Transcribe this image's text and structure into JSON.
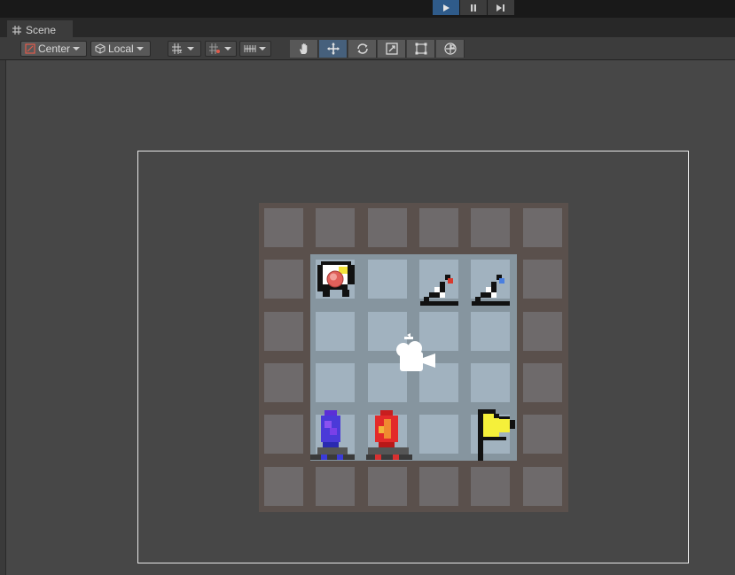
{
  "topbar": {
    "play_controls": [
      {
        "name": "play-button",
        "icon": "play-icon",
        "active": true
      },
      {
        "name": "pause-button",
        "icon": "pause-icon",
        "active": false
      },
      {
        "name": "step-button",
        "icon": "step-icon",
        "active": false
      }
    ]
  },
  "tabs": [
    {
      "label": "Scene",
      "icon": "grid-hash-icon"
    }
  ],
  "toolbar": {
    "pivot_mode": "Center",
    "pivot_rotation": "Local",
    "tools": [
      "hand-tool",
      "move-tool",
      "rotate-tool",
      "scale-tool",
      "rect-tool",
      "transform-tool"
    ],
    "selected_tool": "move-tool"
  },
  "scene": {
    "grid_size": 6,
    "colors": {
      "background": "#474747",
      "wall": "#6e6a6b",
      "floor": "#a1b2bf",
      "board": "#5a504c",
      "frame": "#e8e8e8",
      "accent": "#2f5b8a"
    },
    "objects": [
      {
        "type": "player",
        "icon": "player-sprite-icon",
        "row": 1,
        "col": 1
      },
      {
        "type": "ramp-red",
        "icon": "red-ramp-icon",
        "row": 1,
        "col": 3
      },
      {
        "type": "ramp-blue",
        "icon": "blue-ramp-icon",
        "row": 1,
        "col": 4
      },
      {
        "type": "camera",
        "icon": "camera-gizmo-icon",
        "row": 2.5,
        "col": 2.5
      },
      {
        "type": "blue-crystal",
        "icon": "blue-crystal-icon",
        "row": 4,
        "col": 1
      },
      {
        "type": "red-crystal",
        "icon": "red-crystal-icon",
        "row": 4,
        "col": 2
      },
      {
        "type": "goal-flag",
        "icon": "yellow-flag-icon",
        "row": 4,
        "col": 4
      }
    ]
  }
}
